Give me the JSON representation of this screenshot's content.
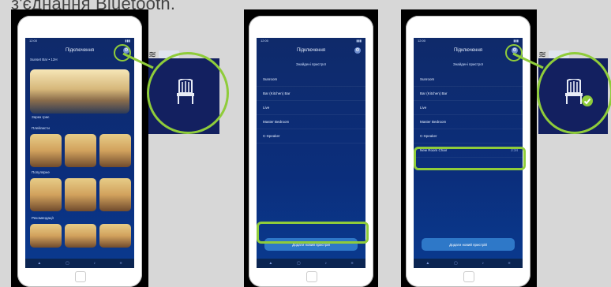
{
  "caption": "з'єднання Bluetooth.",
  "phones": [
    {
      "title": "Підключення",
      "subtitle": "Sunset Bar • 12H",
      "hero_caption": "Зараз грає",
      "sections": [
        "Плейлисти",
        "Популярне",
        "Рекомендації"
      ]
    },
    {
      "title": "Підключення",
      "subtitle": "Знайдені пристрої",
      "rows": [
        "Sunroom",
        "Bar (Kitchen) Bar",
        "Live",
        "Master Bedroom",
        "C-Speaker"
      ],
      "button": "Додати новий пристрій"
    },
    {
      "title": "Підключення",
      "subtitle": "Знайдені пристрої",
      "rows": [
        "Sunroom",
        "Bar (Kitchen) Bar",
        "Live",
        "Master Bedroom",
        "C-Speaker"
      ],
      "highlight_row": "New Room Chair",
      "highlight_meta": "2:34",
      "button": "Додати новий пристрій"
    }
  ],
  "icons": {
    "settings": "gear-icon",
    "chair": "chair-icon",
    "check": "checkmark-icon",
    "wifi": "wifi-icon",
    "battery": "battery-icon",
    "home": "home-button-icon"
  },
  "colors": {
    "highlight": "#8fcc3a",
    "screen": "#0b2e7c"
  }
}
